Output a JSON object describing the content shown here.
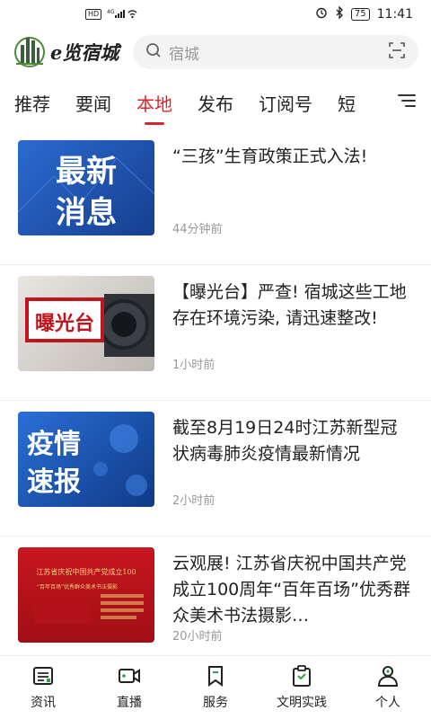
{
  "status": {
    "left": "HD 4G",
    "battery": "75",
    "time": "11:41"
  },
  "app": {
    "logo_text": "e览宿城"
  },
  "search": {
    "placeholder": "宿城"
  },
  "tabs": [
    {
      "label": "推荐",
      "active": false
    },
    {
      "label": "要闻",
      "active": false
    },
    {
      "label": "本地",
      "active": true
    },
    {
      "label": "发布",
      "active": false
    },
    {
      "label": "订阅号",
      "active": false
    },
    {
      "label": "短",
      "active": false
    }
  ],
  "news": [
    {
      "thumb_lines": [
        "最新",
        "消息"
      ],
      "title": "“三孩”生育政策正式入法!",
      "time": "44分钟前"
    },
    {
      "thumb_lines": [
        "曝光台"
      ],
      "title": "【曝光台】严查! 宿城这些工地存在环境污染, 请迅速整改!",
      "time": "1小时前"
    },
    {
      "thumb_lines": [
        "疫情",
        "速报"
      ],
      "title": "截至8月19日24时江苏新型冠状病毒肺炎疫情最新情况",
      "time": "2小时前"
    },
    {
      "thumb_lines": [
        "江苏省庆祝中国共产党成立100",
        "“百年百场”优秀群众美术书法摄影"
      ],
      "title": "云观展! 江苏省庆祝中国共产党成立100周年“百年百场”优秀群众美术书法摄影…",
      "time": "20小时前"
    }
  ],
  "bottom_nav": [
    {
      "label": "资讯",
      "icon": "news-icon"
    },
    {
      "label": "直播",
      "icon": "video-icon"
    },
    {
      "label": "服务",
      "icon": "bookmark-icon"
    },
    {
      "label": "文明实践",
      "icon": "clipboard-icon"
    },
    {
      "label": "个人",
      "icon": "person-icon"
    }
  ],
  "colors": {
    "accent": "#d9262c",
    "tile_blue": "#1f57b5",
    "tile_red": "#c1141c"
  }
}
